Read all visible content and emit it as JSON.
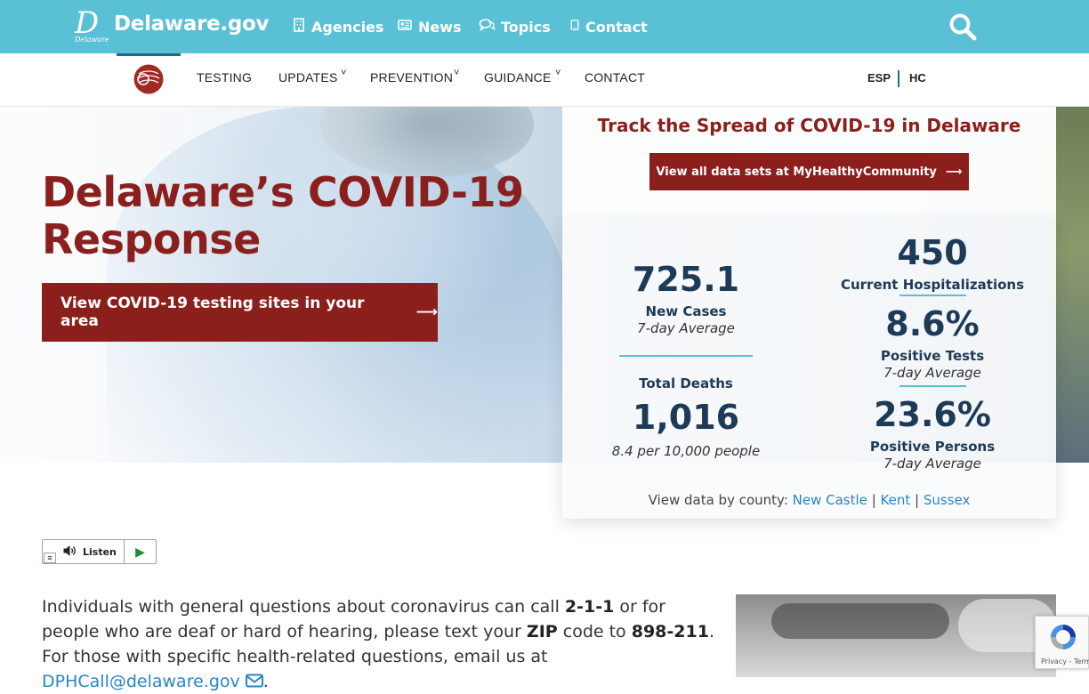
{
  "header": {
    "logo_mark": "D",
    "logo_mark_caption": "Delaware",
    "site_name": "Delaware.gov",
    "nav": [
      {
        "label": "Agencies",
        "icon": "building-icon"
      },
      {
        "label": "News",
        "icon": "newspaper-icon"
      },
      {
        "label": "Topics",
        "icon": "chat-bubbles-icon"
      },
      {
        "label": "Contact",
        "icon": "mobile-phone-icon"
      }
    ],
    "search_icon": "search-icon"
  },
  "subnav": {
    "items": [
      "TESTING",
      "UPDATES",
      "PREVENTION",
      "GUIDANCE",
      "CONTACT"
    ],
    "caret": "˅",
    "languages": [
      "ESP",
      "HC"
    ]
  },
  "hero": {
    "title_line1": "Delaware’s COVID-19",
    "title_line2": "Response",
    "cta_label": "View COVID-19 testing sites in your area",
    "arrow": "⟶"
  },
  "panel": {
    "title": "Track the Spread of COVID-19 in Delaware",
    "button_label": "View all data sets at MyHealthyCommunity",
    "arrow": "⟶",
    "new_cases": {
      "value": "725.1",
      "label": "New Cases",
      "sub": "7-day Average"
    },
    "total_deaths": {
      "label": "Total Deaths",
      "value": "1,016",
      "sub": "8.4 per 10,000 people"
    },
    "hospitalizations": {
      "value": "450",
      "label": "Current Hospitalizations"
    },
    "positive_tests": {
      "value": "8.6%",
      "label": "Positive Tests",
      "sub": "7-day Average"
    },
    "positive_persons": {
      "value": "23.6%",
      "label": "Positive Persons",
      "sub": "7-day Average"
    },
    "county_prefix": "View data by county:",
    "counties": [
      "New Castle",
      "Kent",
      "Sussex"
    ],
    "separator": "|"
  },
  "listen": {
    "label": "Listen",
    "play": "▶",
    "menu": "≡"
  },
  "body": {
    "part1": "Individuals with general questions about coronavirus can call ",
    "phone": "2-1-1",
    "part2": " or for people who are deaf or hard of hearing, please text your ",
    "zip": "ZIP",
    "part3": " code to ",
    "text_number": "898-211",
    "part4": ". For those with specific health-related questions, email us at ",
    "email": "DPHCall@delaware.gov",
    "part5": "."
  },
  "recaptcha": {
    "terms": "Privacy - Terms"
  },
  "colors": {
    "header_bg": "#5ac0d6",
    "brand_red": "#8b1f1c",
    "stat_navy": "#1d3a57",
    "link": "#2a86c3"
  }
}
